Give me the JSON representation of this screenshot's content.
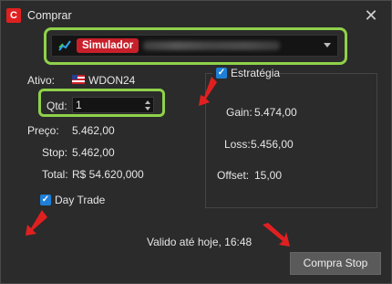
{
  "window": {
    "title": "Comprar",
    "app_icon_letter": "C"
  },
  "account": {
    "badge": "Simulador"
  },
  "asset": {
    "label": "Ativo:",
    "value": "WDON24"
  },
  "quantity": {
    "label": "Qtd:",
    "value": "1"
  },
  "price": {
    "label": "Preço:",
    "value": "5.462,00"
  },
  "stop": {
    "label": "Stop:",
    "value": "5.462,00"
  },
  "total": {
    "label": "Total:",
    "value": "R$ 54.620,000"
  },
  "day_trade": {
    "label": "Day Trade",
    "checked": true
  },
  "strategy": {
    "label": "Estratégia",
    "checked": true,
    "gain_label": "Gain:",
    "gain_value": "5.474,00",
    "loss_label": "Loss:",
    "loss_value": "5.456,00",
    "offset_label": "Offset:",
    "offset_value": "15,00"
  },
  "validity": "Valido até hoje, 16:48",
  "submit_label": "Compra Stop",
  "colors": {
    "highlight": "#8fd14a",
    "badge": "#c8202a",
    "checkbox": "#1e7fd8",
    "annotation_arrow": "#e02020"
  }
}
